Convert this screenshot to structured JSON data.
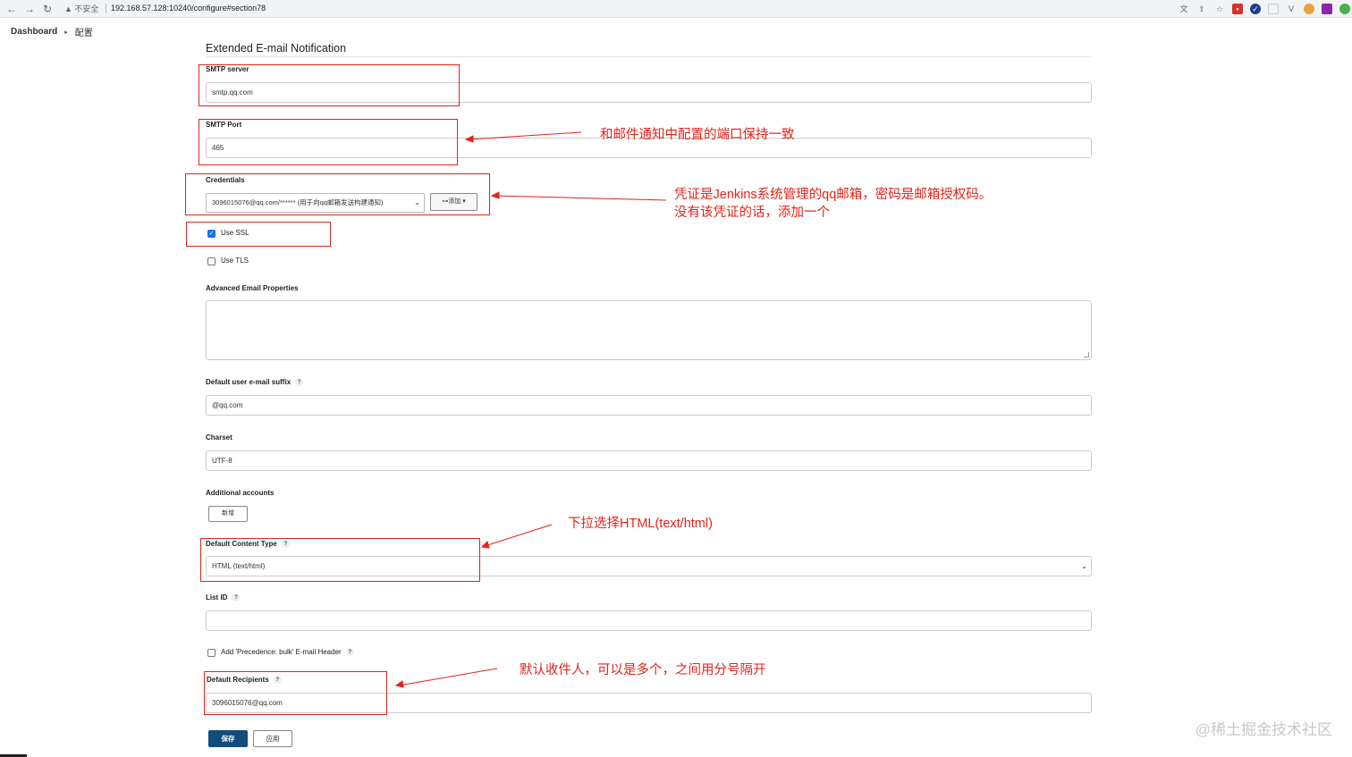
{
  "browser": {
    "security_label": "不安全",
    "url": "192.168.57.128:10240/configure#section78"
  },
  "breadcrumb": {
    "dashboard": "Dashboard",
    "current": "配置"
  },
  "section": {
    "title": "Extended E-mail Notification"
  },
  "form": {
    "smtp_server_label": "SMTP server",
    "smtp_server_value": "smtp.qq.com",
    "smtp_port_label": "SMTP Port",
    "smtp_port_value": "465",
    "credentials_label": "Credentials",
    "credentials_value": "3096015076@qq.com/****** (用于向qq邮箱发送构建通知)",
    "add_button": "添加",
    "use_ssl_label": "Use SSL",
    "use_ssl_checked": true,
    "use_tls_label": "Use TLS",
    "use_tls_checked": false,
    "advanced_props_label": "Advanced Email Properties",
    "default_suffix_label": "Default user e-mail suffix",
    "default_suffix_value": "@qq.com",
    "charset_label": "Charset",
    "charset_value": "UTF-8",
    "additional_accounts_label": "Additional accounts",
    "new_button": "新增",
    "content_type_label": "Default Content Type",
    "content_type_value": "HTML (text/html)",
    "list_id_label": "List ID",
    "list_id_value": "",
    "precedence_label": "Add 'Precedence: bulk' E-mail Header",
    "precedence_checked": false,
    "recipients_label": "Default Recipients",
    "recipients_value": "3096015076@qq.com",
    "help_mark": "?",
    "save_button": "保存",
    "apply_button": "应用"
  },
  "annotations": {
    "port_note": "和邮件通知中配置的端口保持一致",
    "cred_note_1": "凭证是Jenkins系统管理的qq邮箱，密码是邮箱授权码。",
    "cred_note_2": "没有该凭证的话，添加一个",
    "content_type_note": "下拉选择HTML(text/html)",
    "recipients_note": "默认收件人，可以是多个，之间用分号隔开"
  },
  "watermark": "@稀土掘金技术社区",
  "colors": {
    "annotation_red": "#e2231a",
    "save_blue": "#134b7a"
  }
}
